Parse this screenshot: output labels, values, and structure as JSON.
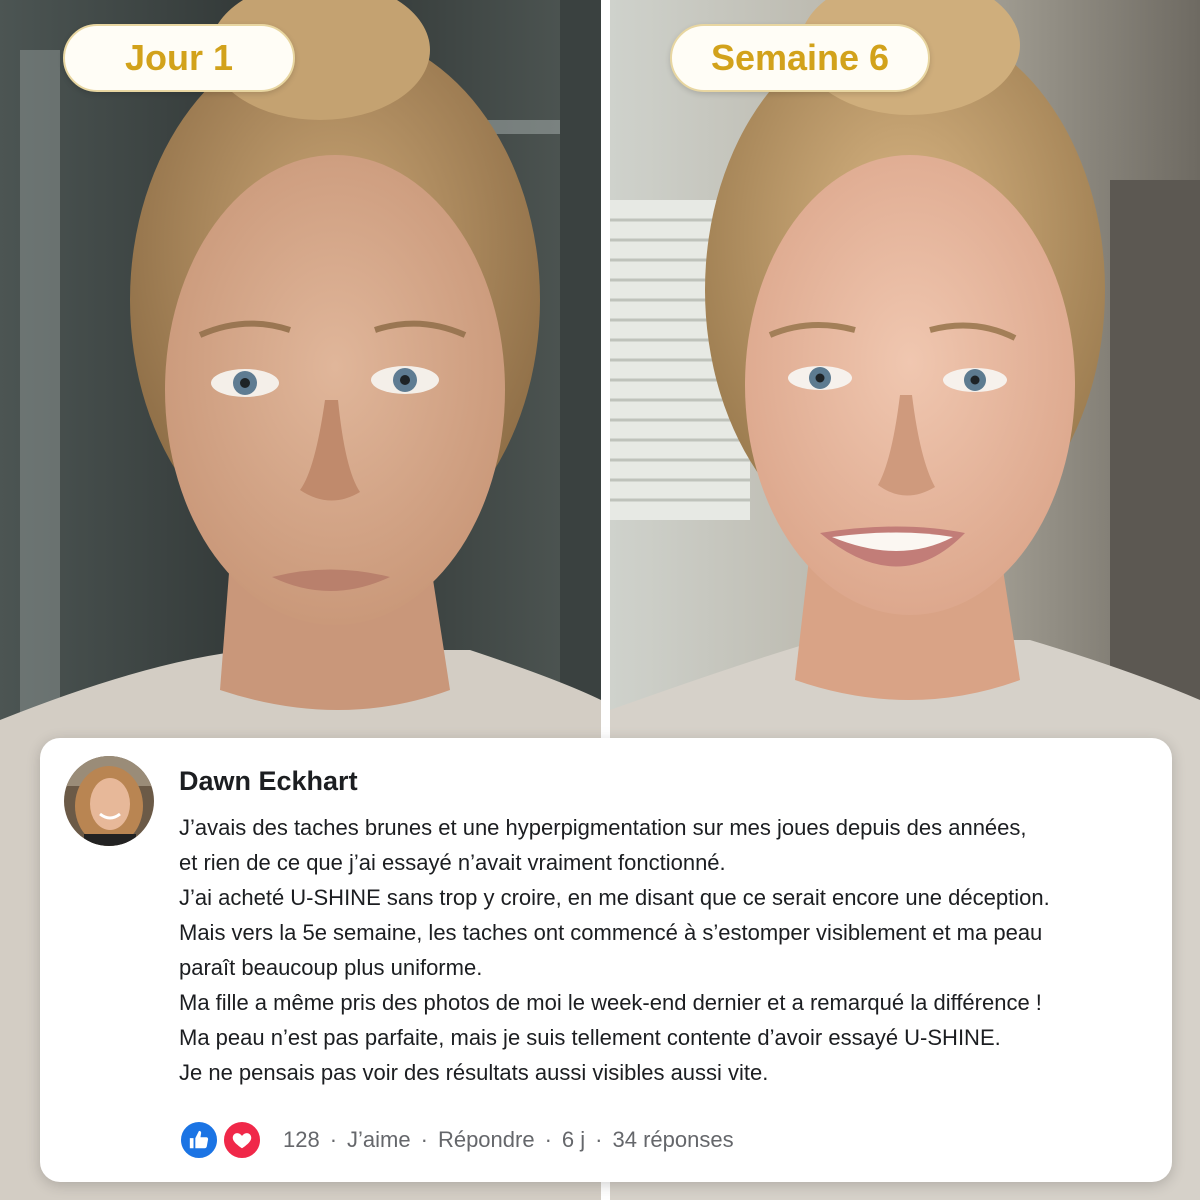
{
  "labels": {
    "before": "Jour 1",
    "after": "Semaine 6"
  },
  "comment": {
    "author": "Dawn Eckhart",
    "lines": [
      "J’avais des taches brunes et une hyperpigmentation sur mes joues depuis des années,",
      "et rien de ce que j’ai essayé n’avait vraiment fonctionné.",
      "J’ai acheté U-SHINE sans trop y croire, en me disant que ce serait encore une déception.",
      "Mais vers la 5e semaine, les taches ont commencé à s’estomper visiblement et ma peau",
      "paraît beaucoup plus uniforme.",
      "Ma fille a même pris des photos de moi le week-end dernier et a remarqué la différence !",
      "Ma peau n’est pas parfaite, mais je suis tellement contente d’avoir essayé U-SHINE.",
      "Je ne pensais pas voir des résultats aussi visibles aussi vite."
    ],
    "reaction_count": "128",
    "like_label": "J’aime",
    "reply_label": "Répondre",
    "age": "6 j",
    "replies": "34 réponses",
    "reaction_icons": [
      "thumbs-up-icon",
      "heart-icon"
    ]
  },
  "colors": {
    "label_text": "#d2a21b",
    "like_blue": "#1b74e4",
    "love_red": "#f02849",
    "meta_gray": "#65676b"
  }
}
